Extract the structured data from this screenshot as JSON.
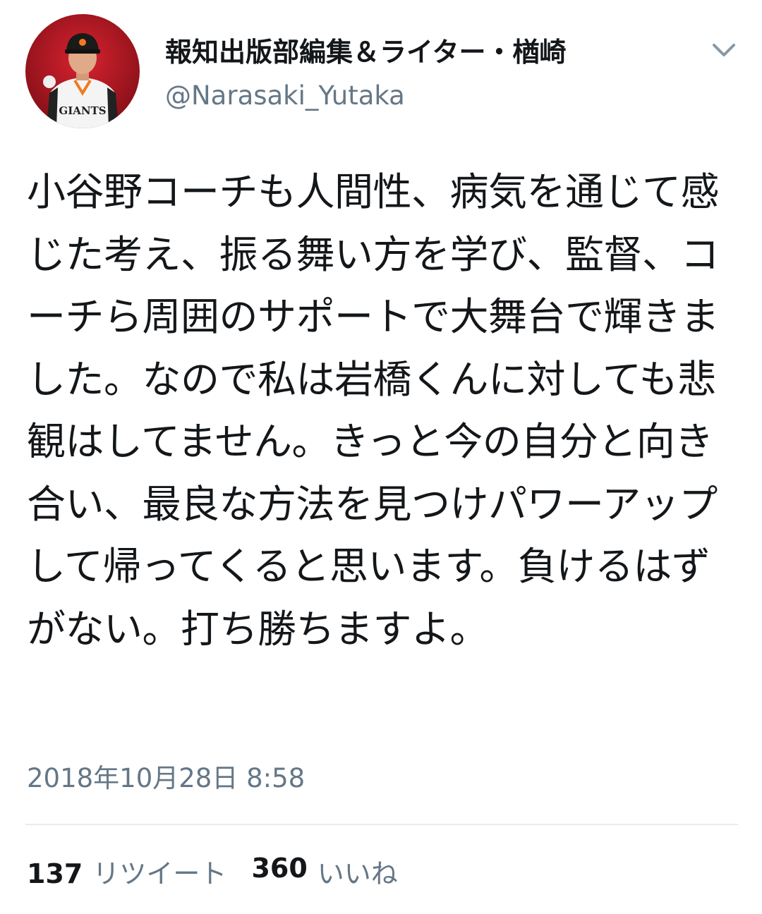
{
  "tweet": {
    "author": {
      "display_name": "報知出版部編集＆ライター・楢崎",
      "handle": "@Narasaki_Yutaka",
      "avatar_icon": "avatar-baseball-player",
      "avatar_jersey_text": "GIANTS"
    },
    "menu_icon": "chevron-down-icon",
    "text": "小谷野コーチも人間性、病気を通じて感じた考え、振る舞い方を学び、監督、コーチら周囲のサポートで大舞台で輝きました。なので私は岩橋くんに対しても悲観はしてません。きっと今の自分と向き合い、最良な方法を見つけパワーアップして帰ってくると思います。負けるはずがない。打ち勝ちますよ。",
    "timestamp": "2018年10月28日 8:58",
    "stats": {
      "retweets_count": "137",
      "retweets_label": "リツイート",
      "likes_count": "360",
      "likes_label": "いいね"
    }
  },
  "colors": {
    "text_primary": "#14171a",
    "text_secondary": "#657786",
    "divider": "#e6ecf0",
    "giants_orange": "#f07a1e"
  }
}
